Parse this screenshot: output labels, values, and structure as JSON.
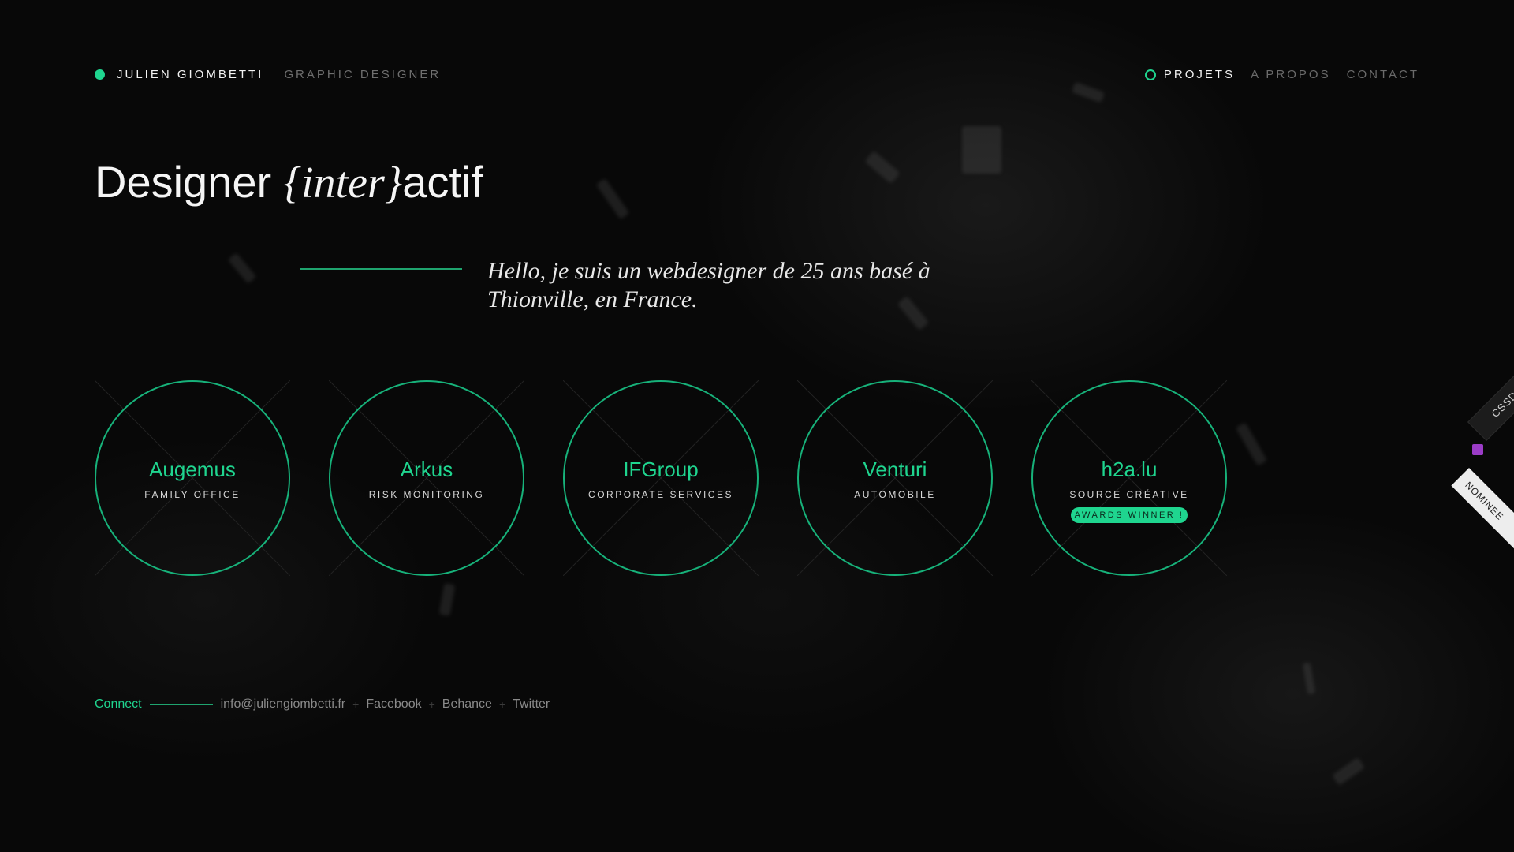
{
  "brand": {
    "name": "JULIEN GIOMBETTI",
    "role": "GRAPHIC DESIGNER",
    "accent": "#1fd58f"
  },
  "nav": {
    "items": [
      {
        "label": "PROJETS",
        "active": true
      },
      {
        "label": "A PROPOS",
        "active": false
      },
      {
        "label": "CONTACT",
        "active": false
      }
    ]
  },
  "headline": {
    "prefix": "Designer ",
    "italic": "{inter}",
    "suffix": "actif"
  },
  "intro": {
    "text": "Hello, je suis un webdesigner de 25 ans basé à Thionville, en France."
  },
  "projects": [
    {
      "title": "Augemus",
      "subtitle": "FAMILY OFFICE"
    },
    {
      "title": "Arkus",
      "subtitle": "RISK MONITORING"
    },
    {
      "title": "IFGroup",
      "subtitle": "CORPORATE SERVICES"
    },
    {
      "title": "Venturi",
      "subtitle": "AUTOMOBILE"
    },
    {
      "title": "h2a.lu",
      "subtitle": "SOURCE CRÉATIVE",
      "badge": "AWARDS WINNER !"
    }
  ],
  "ribbon": {
    "top": "CSSDA",
    "bottom": "NOMINEE"
  },
  "connect": {
    "label": "Connect",
    "links": [
      "info@juliengiombetti.fr",
      "Facebook",
      "Behance",
      "Twitter"
    ],
    "separator": "+"
  }
}
